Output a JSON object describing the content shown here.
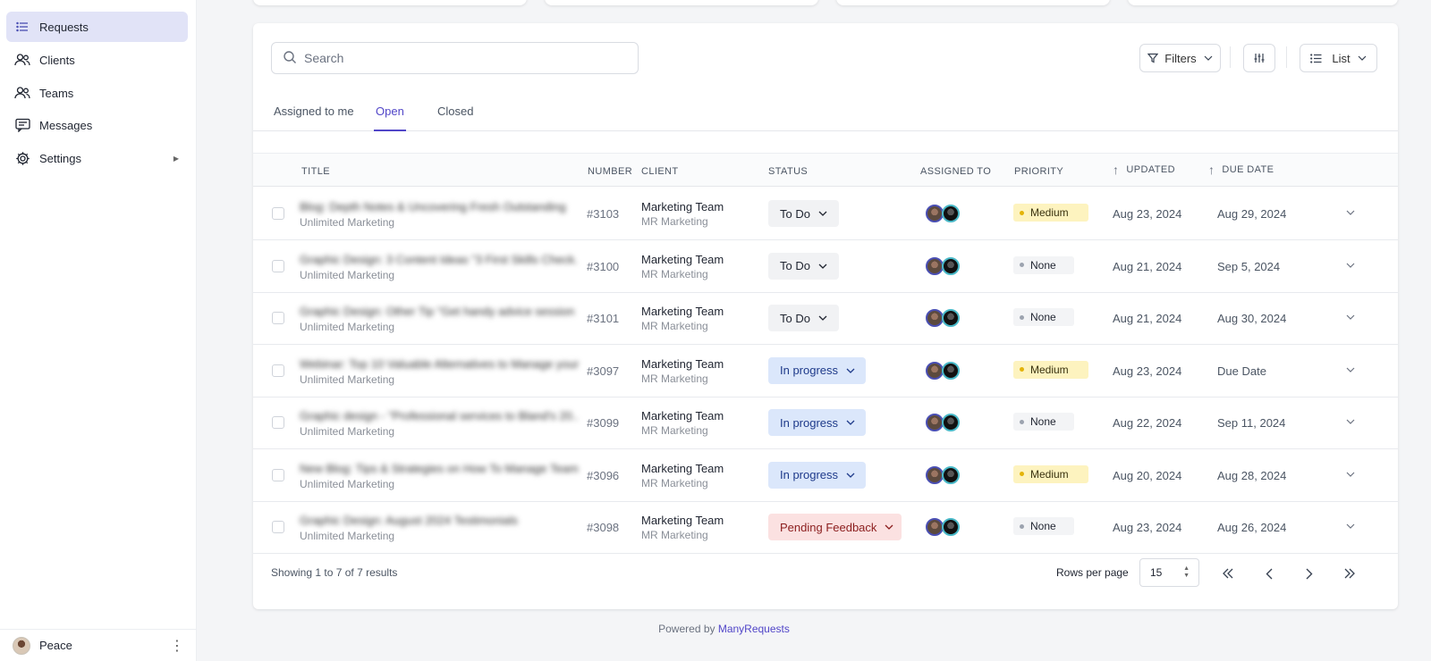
{
  "sidebar": {
    "items": [
      {
        "label": "Requests",
        "icon": "list-icon",
        "active": true
      },
      {
        "label": "Clients",
        "icon": "users-icon"
      },
      {
        "label": "Teams",
        "icon": "team-icon"
      },
      {
        "label": "Messages",
        "icon": "message-icon"
      },
      {
        "label": "Settings",
        "icon": "gear-icon",
        "caret": "▶"
      }
    ],
    "user": {
      "name": "Peace",
      "menu": "⋮"
    }
  },
  "toolbar": {
    "search_placeholder": "Search",
    "filters_label": "Filters",
    "view_label": "List"
  },
  "tabs": [
    "Assigned to me",
    "Open",
    "Closed"
  ],
  "active_tab": "Open",
  "columns": {
    "title": "TITLE",
    "number": "NUMBER",
    "client": "CLIENT",
    "status": "STATUS",
    "assigned": "ASSIGNED TO",
    "priority": "PRIORITY",
    "updated": "UPDATED",
    "due": "DUE DATE"
  },
  "rows": [
    {
      "title": "Blog: Depth Notes & Uncovering Fresh Outstanding",
      "org": "Unlimited Marketing",
      "number": "#3103",
      "client": "Marketing Team",
      "client_sub": "MR Marketing",
      "status": "To Do",
      "priority": "Medium",
      "updated": "Aug 23, 2024",
      "due": "Aug 29, 2024"
    },
    {
      "title": "Graphic Design: 3 Content Ideas \"3 First Skills Check...",
      "org": "Unlimited Marketing",
      "number": "#3100",
      "client": "Marketing Team",
      "client_sub": "MR Marketing",
      "status": "To Do",
      "priority": "None",
      "updated": "Aug 21, 2024",
      "due": "Sep 5, 2024"
    },
    {
      "title": "Graphic Design: Other Tip \"Get handy advice session ...",
      "org": "Unlimited Marketing",
      "number": "#3101",
      "client": "Marketing Team",
      "client_sub": "MR Marketing",
      "status": "To Do",
      "priority": "None",
      "updated": "Aug 21, 2024",
      "due": "Aug 30, 2024"
    },
    {
      "title": "Webinar: Top 10 Valuable Alternatives to Manage your ...",
      "org": "Unlimited Marketing",
      "number": "#3097",
      "client": "Marketing Team",
      "client_sub": "MR Marketing",
      "status": "In progress",
      "priority": "Medium",
      "updated": "Aug 23, 2024",
      "due": "Due Date"
    },
    {
      "title": "Graphic design - \"Professional services to Bland's 20...",
      "org": "Unlimited Marketing",
      "number": "#3099",
      "client": "Marketing Team",
      "client_sub": "MR Marketing",
      "status": "In progress",
      "priority": "None",
      "updated": "Aug 22, 2024",
      "due": "Sep 11, 2024"
    },
    {
      "title": "New Blog: Tips & Strategies on How To Manage Team ...",
      "org": "Unlimited Marketing",
      "number": "#3096",
      "client": "Marketing Team",
      "client_sub": "MR Marketing",
      "status": "In progress",
      "priority": "Medium",
      "updated": "Aug 20, 2024",
      "due": "Aug 28, 2024"
    },
    {
      "title": "Graphic Design: August 2024 Testimonials",
      "org": "Unlimited Marketing",
      "number": "#3098",
      "client": "Marketing Team",
      "client_sub": "MR Marketing",
      "status": "Pending Feedback",
      "priority": "None",
      "updated": "Aug 23, 2024",
      "due": "Aug 26, 2024"
    }
  ],
  "footer": {
    "summary": "Showing 1 to 7 of 7 results",
    "rows_per_page_label": "Rows per page",
    "rows_per_page_value": "15"
  },
  "powered_by": {
    "prefix": "Powered by ",
    "brand": "ManyRequests"
  },
  "colors": {
    "accent": "#5146c8",
    "active_nav_bg": "#e1e3f7"
  }
}
